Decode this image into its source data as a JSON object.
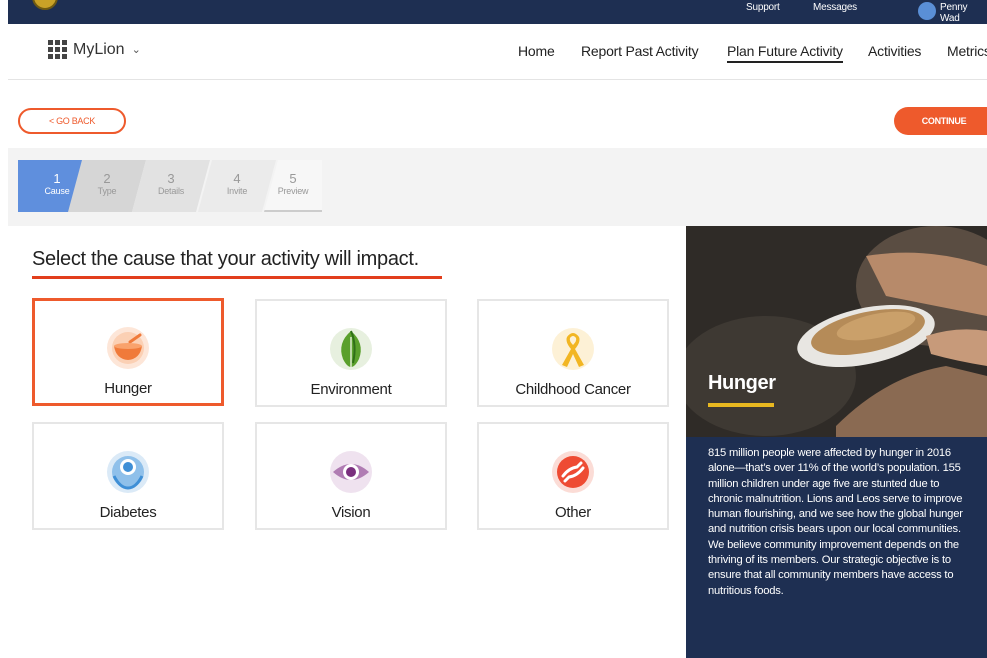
{
  "topbar": {
    "support": "Support",
    "messages": "Messages",
    "user": "Penny Wad"
  },
  "nav": {
    "brand": "MyLion",
    "links": [
      "Home",
      "Report Past Activity",
      "Plan Future Activity",
      "Activities",
      "Metrics"
    ],
    "active_link": "Plan Future Activity"
  },
  "actions": {
    "back": "< GO BACK",
    "continue": "CONTINUE"
  },
  "steps": [
    {
      "num": "1",
      "label": "Cause"
    },
    {
      "num": "2",
      "label": "Type"
    },
    {
      "num": "3",
      "label": "Details"
    },
    {
      "num": "4",
      "label": "Invite"
    },
    {
      "num": "5",
      "label": "Preview"
    }
  ],
  "active_step": "1",
  "main": {
    "heading": "Select the cause that your activity will impact.",
    "causes": [
      {
        "label": "Hunger",
        "icon": "hunger-bowl-icon",
        "selected": true
      },
      {
        "label": "Environment",
        "icon": "leaf-icon",
        "selected": false
      },
      {
        "label": "Childhood Cancer",
        "icon": "ribbon-icon",
        "selected": false
      },
      {
        "label": "Diabetes",
        "icon": "diabetes-drop-icon",
        "selected": false
      },
      {
        "label": "Vision",
        "icon": "eye-icon",
        "selected": false
      },
      {
        "label": "Other",
        "icon": "helping-hands-icon",
        "selected": false
      }
    ]
  },
  "panel": {
    "title": "Hunger",
    "text": "815 million people were affected by hunger in 2016 alone—that’s over 11% of the world’s population. 155 million children under age five are stunted due to chronic malnutrition. Lions and Leos serve to improve human flourishing, and we see how the global hunger and nutrition crisis bears upon our local communities. We believe community improvement depends on the thriving of its members. Our strategic objective is to ensure that all community members have access to nutritious foods."
  },
  "colors": {
    "navy": "#1e2f52",
    "accent": "#ee5a2c",
    "step_active": "#5f8fdd",
    "title_bar": "#e8b820"
  }
}
